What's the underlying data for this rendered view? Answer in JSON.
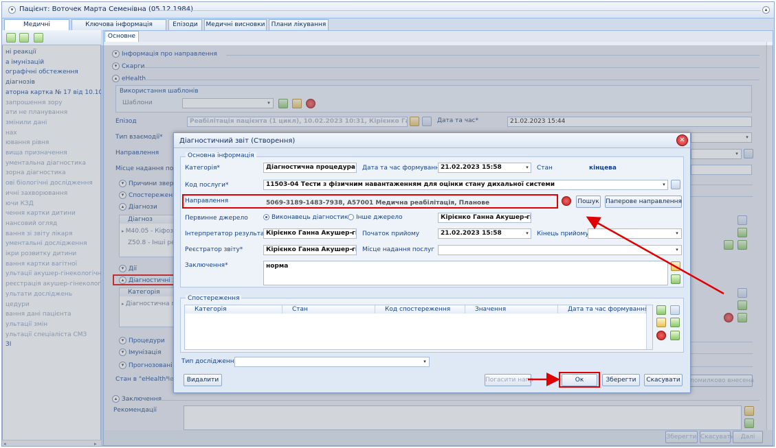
{
  "window": {
    "title": "Пацієнт: Воточек Марта Семенівна (05.12.1984)"
  },
  "tabs": [
    "Медичні документи",
    "Ключова інформація пацієнта",
    "Епізоди",
    "Медичні висновки",
    "Плани лікування"
  ],
  "left_panel": {
    "items": [
      {
        "label": "ні реакції",
        "dim": false
      },
      {
        "label": "а імунізацій",
        "dim": false
      },
      {
        "label": "ографічні обстеження",
        "dim": false
      },
      {
        "label": "діагнозів",
        "dim": false
      },
      {
        "label": "аторна картка № 17 від 10.10.2022",
        "dim": false
      },
      {
        "label": "запрошення зору",
        "dim": true
      },
      {
        "label": "ати не планування",
        "dim": true
      },
      {
        "label": "змінили дані",
        "dim": true
      },
      {
        "label": "нах",
        "dim": true
      },
      {
        "label": "ювання рівня",
        "dim": true
      },
      {
        "label": "вища призначення",
        "dim": true
      },
      {
        "label": "ументальна діагностика",
        "dim": true
      },
      {
        "label": "зорна діагностика",
        "dim": true
      },
      {
        "label": "ові біологічні дослідження",
        "dim": true
      },
      {
        "label": "ичні захворювання",
        "dim": true
      },
      {
        "label": "ючи КЗД",
        "dim": true
      },
      {
        "label": "чення картки дитини",
        "dim": true
      },
      {
        "label": "нансовий огляд",
        "dim": true
      },
      {
        "label": "вання зі звіту лікаря",
        "dim": true
      },
      {
        "label": "ументальні дослідження",
        "dim": true
      },
      {
        "label": "ікри розвитку дитини",
        "dim": true
      },
      {
        "label": "вання картки вагітної",
        "dim": true
      },
      {
        "label": "ультації акушер-гінекологічні",
        "dim": true
      },
      {
        "label": "реєстрація акушер-гінекологічна",
        "dim": true
      },
      {
        "label": "ультати досліджень",
        "dim": true
      },
      {
        "label": "цедури",
        "dim": true
      },
      {
        "label": "вання дані пацієнта",
        "dim": true
      },
      {
        "label": "ультації змін",
        "dim": true
      },
      {
        "label": "ультації спеціаліста СМЗ",
        "dim": true
      },
      {
        "label": "ЗІ",
        "dim": false
      }
    ]
  },
  "right_panel": {
    "tab": "Основне",
    "sections": {
      "referral_info": "Інформація про направлення",
      "complaints": "Скарги",
      "ehealth": "eHealth",
      "template_usage": "Використання шаблонів",
      "templates_label": "Шаблони",
      "episode_label": "Епізод",
      "episode_value": "Реабілітація пацієнта (1 цикл), 10.02.2023 10:31, Кірієнко Ганна Акуше",
      "datetime_label": "Дата та час*",
      "datetime_value": "21.02.2023 15:44",
      "interaction_type": "Тип взаємодії*",
      "referral": "Направлення",
      "service_place": "Місце надання послу",
      "reasons": "Причини зверне",
      "observations": "Спостереження",
      "diagnoses": "Діагнози",
      "diag_col": "Діагноз",
      "diag_row1": "M40.05 - Кіфоз і",
      "diag_row2": "Z50.8 - Інші реаб",
      "actions": "Дії",
      "diag_reports": "Діагностичні звіт",
      "category_col": "Категорія",
      "category_row": "Діагностична пр",
      "procedures": "Процедури",
      "immunization": "Імунізація",
      "forecast": "Прогнозовані ва",
      "ehealth_status": "Стан в \"eHealth\"",
      "ehealth_status_val": "Че",
      "error_btn": "помилково внесена",
      "conclusion": "Заключення",
      "recommendations": "Рекомендації",
      "save": "Зберегти",
      "cancel": "Скасувати",
      "next": "Далі"
    }
  },
  "dialog": {
    "title": "Діагностичний звіт (Створення)",
    "basic_info": "Основна інформація",
    "category_label": "Категорія*",
    "category_value": "Діагностична процедура",
    "formed_label": "Дата та час формування*",
    "formed_value": "21.02.2023 15:58",
    "status_label": "Стан",
    "status_value": "кінцева",
    "service_code_label": "Код послуги*",
    "service_code_value": "11503-04 Тести з фізичним навантаженням для оцінки стану дихальної системи",
    "referral_label": "Направлення",
    "referral_value": "5069-3189-1483-7938, A57001 Медична реабілітація, Планове",
    "search_btn": "Пошук",
    "paper_btn": "Паперове направлення",
    "source_label": "Первинне джерело",
    "source_opt1": "Виконавець діагностики",
    "source_opt2": "Інше джерело",
    "source_person": "Кірієнко Ганна Акушер-гіне",
    "interpreter_label": "Інтерпретатор результату*",
    "interpreter_value": "Кірієнко Ганна Акушер-гіне",
    "start_label": "Початок прийому",
    "start_value": "21.02.2023 15:58",
    "end_label": "Кінець прийому",
    "registrar_label": "Реєстратор звіту*",
    "registrar_value": "Кірієнко Ганна Акушер-гіне",
    "place_label": "Місце надання послуг",
    "conclusion_label": "Заключення*",
    "conclusion_value": "норма",
    "observations_legend": "Спостереження",
    "obs_columns": [
      "Категорія",
      "Стан",
      "Код спостереження",
      "Значення",
      "Дата та час формування"
    ],
    "study_type_label": "Тип дослідження",
    "delete_btn": "Видалити",
    "repay_btn": "Погасити напр",
    "ok_btn": "Ок",
    "save_btn": "Зберегти",
    "cancel_btn": "Скасувати"
  }
}
